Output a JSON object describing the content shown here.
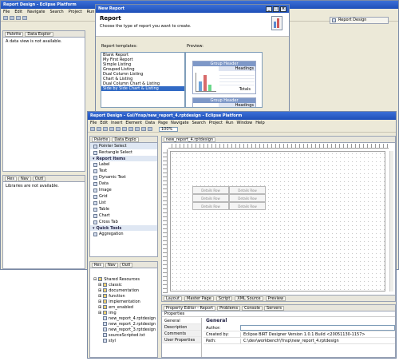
{
  "back_window": {
    "title": "Report Design - Eclipse Platform",
    "menu": [
      "File",
      "Edit",
      "Navigate",
      "Search",
      "Project",
      "Run"
    ],
    "perspective_button": "Report Design",
    "left_tabs": [
      "Palette",
      "Data Explor"
    ],
    "left_message": "A data view is not available.",
    "bottom_tabs": [
      "Res",
      "Nav",
      "Outl"
    ],
    "bottom_message": "Libraries are not available."
  },
  "dialog": {
    "title": "New Report",
    "heading": "Report",
    "subtitle": "Choose the type of report you want to create.",
    "templates_label": "Report templates:",
    "preview_label": "Preview:",
    "templates": [
      "Blank Report",
      "My First Report",
      "Simple Listing",
      "Grouped Listing",
      "Dual Column Listing",
      "Chart & Listing",
      "Dual Column Chart & Listing",
      "Side by Side Chart & Listing"
    ],
    "selected_index": 7,
    "preview": {
      "group_header": "Group Header",
      "headings": "Headings",
      "totals": "Totals"
    }
  },
  "front_window": {
    "title": "Report Design - Gsi/Ynsp/new_report_4.rptdesign - Eclipse Platform",
    "menu": [
      "File",
      "Edit",
      "Insert",
      "Element",
      "Data",
      "Page",
      "Navigate",
      "Search",
      "Project",
      "Run",
      "Window",
      "Help"
    ],
    "zoom": "100%",
    "palette_tabs": [
      "Palette",
      "Data Explo"
    ],
    "palette": {
      "pointer": "Pointer Select",
      "rect": "Rectangle Select",
      "report_items_header": "Report Items",
      "items": [
        "Label",
        "Text",
        "Dynamic Text",
        "Data",
        "Image",
        "Grid",
        "List",
        "Table",
        "Chart",
        "Cross Tab"
      ],
      "quick_tools_header": "Quick Tools",
      "quick_items": [
        "Aggregation"
      ]
    },
    "resource_tabs": [
      "Res",
      "Nav",
      "Outl"
    ],
    "resource_tree": {
      "root": "Shared Resources",
      "items": [
        "classic",
        "documentation",
        "function",
        "implementation",
        "ern_enabled",
        "img",
        "new_report_4.rptdesign",
        "new_report_2.rptdesign",
        "new_report_3.rptdesign",
        "sourceScripted.txt",
        "styl"
      ]
    },
    "editor_tab": "new_report_4.rptdesign",
    "table_cells": [
      "Details Row",
      "Details Row",
      "Details Row",
      "Details Row",
      "Details Row",
      "Details Row"
    ],
    "bottom_editor_tabs": [
      "Layout",
      "Master Page",
      "Script",
      "XML Source",
      "Preview"
    ],
    "property_tabs": [
      "Property Editor - Report",
      "Problems",
      "Console",
      "Servers"
    ],
    "properties_label": "Properties",
    "property_side": [
      "General",
      "Description",
      "Comments",
      "User Properties"
    ],
    "general_header": "General",
    "props": [
      {
        "k": "Author:",
        "v": ""
      },
      {
        "k": "Created by:",
        "v": "Eclipse BIRT Designer Version 1.0.1 Build <20051130-1157>"
      },
      {
        "k": "Path:",
        "v": "C:\\dev\\workbench\\Ynsp\\new_report_4.rptdesign"
      }
    ],
    "colors": {
      "title_blue": "#1d4fb8",
      "selection": "#316ac5"
    }
  }
}
